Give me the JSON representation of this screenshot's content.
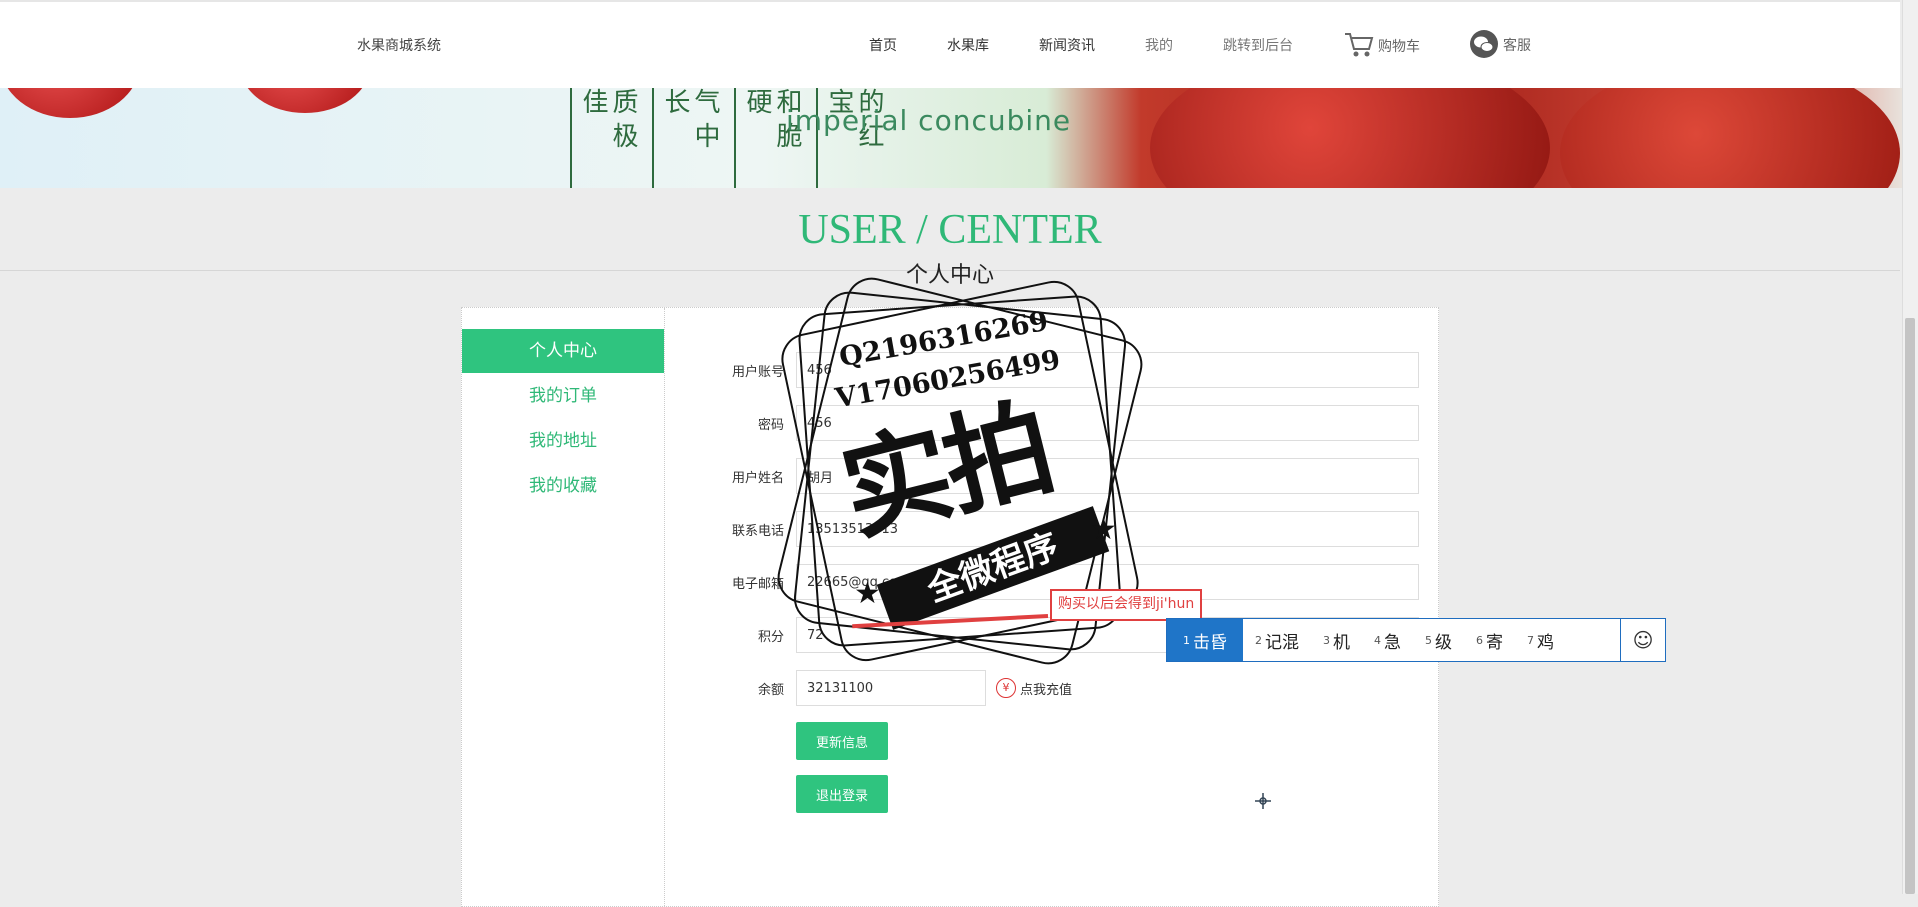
{
  "header": {
    "site_title": "水果商城系统",
    "nav": [
      {
        "label": "首页"
      },
      {
        "label": "水果库"
      },
      {
        "label": "新闻资讯"
      },
      {
        "label": "我的"
      },
      {
        "label": "跳转到后台"
      },
      {
        "label": "购物车",
        "icon": "cart-icon"
      },
      {
        "label": "客服",
        "icon": "wechat-icon"
      }
    ]
  },
  "banner": {
    "poem_columns": [
      "质极佳",
      "气中长",
      "和脆硬",
      "的红宝"
    ],
    "english_text": "imperial concubine"
  },
  "section": {
    "title": "USER / CENTER",
    "subtitle": "个人中心"
  },
  "sidebar": {
    "items": [
      {
        "label": "个人中心",
        "active": true
      },
      {
        "label": "我的订单"
      },
      {
        "label": "我的地址"
      },
      {
        "label": "我的收藏"
      }
    ]
  },
  "form": {
    "fields": [
      {
        "label": "用户账号",
        "value": "456"
      },
      {
        "label": "密码",
        "value": "456"
      },
      {
        "label": "用户姓名",
        "value": "胡月"
      },
      {
        "label": "联系电话",
        "value": "13513513513"
      },
      {
        "label": "电子邮箱",
        "value": "22665@qq.com"
      },
      {
        "label": "积分",
        "value": "72"
      },
      {
        "label": "余额",
        "value": "32131100"
      }
    ],
    "recharge_label": "点我充值",
    "update_button": "更新信息",
    "logout_button": "退出登录"
  },
  "watermark": {
    "line1": "Q2196316269",
    "line2": "V17060256499",
    "big_text": "实拍",
    "ribbon_text": "全微程序"
  },
  "tooltip": {
    "text": "购买以后会得到ji'hun"
  },
  "ime": {
    "candidates": [
      {
        "num": "1",
        "text": "击昏",
        "active": true
      },
      {
        "num": "2",
        "text": "记混"
      },
      {
        "num": "3",
        "text": "机"
      },
      {
        "num": "4",
        "text": "急"
      },
      {
        "num": "5",
        "text": "级"
      },
      {
        "num": "6",
        "text": "寄"
      },
      {
        "num": "7",
        "text": "鸡"
      }
    ],
    "emoji_icon": "smiley-icon"
  },
  "colors": {
    "accent": "#2fc47f",
    "title_green": "#2fb877",
    "ime_blue": "#1f75c8",
    "tooltip_red": "#e04040"
  }
}
